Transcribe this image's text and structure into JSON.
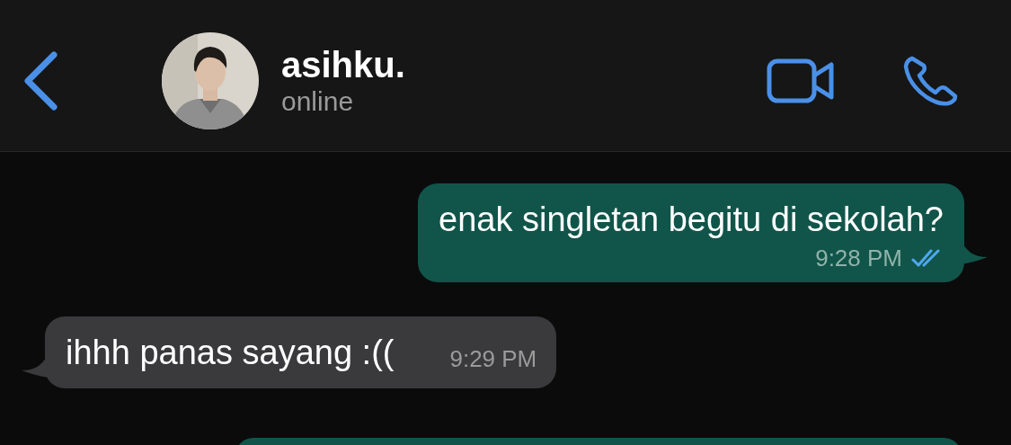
{
  "header": {
    "contact_name": "asihku.",
    "status": "online"
  },
  "messages": [
    {
      "kind": "outgoing",
      "text": "enak singletan begitu di sekolah?",
      "time": "9:28 PM",
      "read": true
    },
    {
      "kind": "incoming",
      "text": "ihhh panas sayang :((",
      "time": "9:29 PM"
    }
  ]
}
